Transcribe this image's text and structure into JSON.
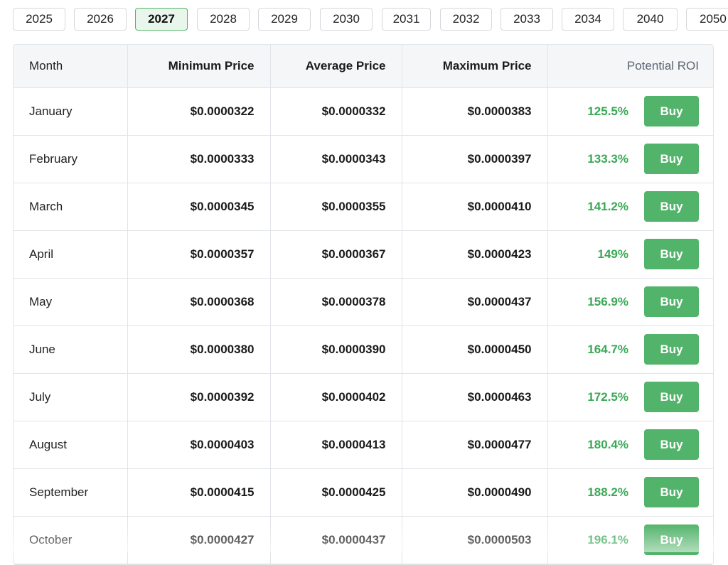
{
  "years": [
    "2025",
    "2026",
    "2027",
    "2028",
    "2029",
    "2030",
    "2031",
    "2032",
    "2033",
    "2034",
    "2040",
    "2050"
  ],
  "active_year": "2027",
  "table": {
    "headers": {
      "month": "Month",
      "min": "Minimum Price",
      "avg": "Average Price",
      "max": "Maximum Price",
      "roi": "Potential ROI"
    },
    "buy_label": "Buy",
    "rows": [
      {
        "month": "January",
        "min": "$0.0000322",
        "avg": "$0.0000332",
        "max": "$0.0000383",
        "roi": "125.5%"
      },
      {
        "month": "February",
        "min": "$0.0000333",
        "avg": "$0.0000343",
        "max": "$0.0000397",
        "roi": "133.3%"
      },
      {
        "month": "March",
        "min": "$0.0000345",
        "avg": "$0.0000355",
        "max": "$0.0000410",
        "roi": "141.2%"
      },
      {
        "month": "April",
        "min": "$0.0000357",
        "avg": "$0.0000367",
        "max": "$0.0000423",
        "roi": "149%"
      },
      {
        "month": "May",
        "min": "$0.0000368",
        "avg": "$0.0000378",
        "max": "$0.0000437",
        "roi": "156.9%"
      },
      {
        "month": "June",
        "min": "$0.0000380",
        "avg": "$0.0000390",
        "max": "$0.0000450",
        "roi": "164.7%"
      },
      {
        "month": "July",
        "min": "$0.0000392",
        "avg": "$0.0000402",
        "max": "$0.0000463",
        "roi": "172.5%"
      },
      {
        "month": "August",
        "min": "$0.0000403",
        "avg": "$0.0000413",
        "max": "$0.0000477",
        "roi": "180.4%"
      },
      {
        "month": "September",
        "min": "$0.0000415",
        "avg": "$0.0000425",
        "max": "$0.0000490",
        "roi": "188.2%"
      },
      {
        "month": "October",
        "min": "$0.0000427",
        "avg": "$0.0000437",
        "max": "$0.0000503",
        "roi": "196.1%"
      }
    ]
  },
  "colors": {
    "accent": "#52b36a",
    "roi_text": "#3aa856",
    "header_bg": "#f5f6f8",
    "active_tab_bg": "#e8f6ec"
  }
}
